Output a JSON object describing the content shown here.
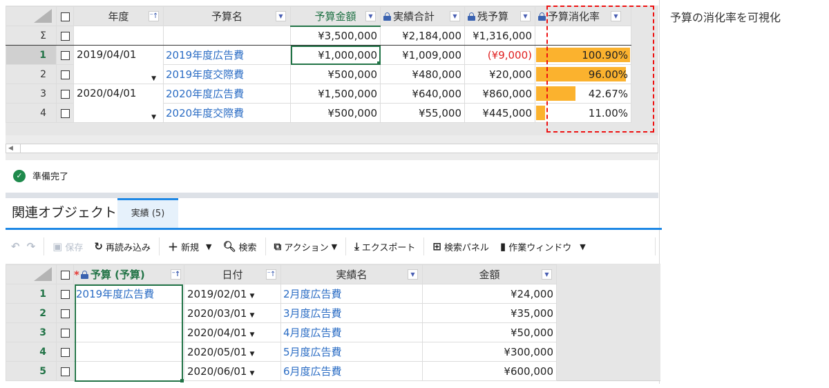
{
  "annotation": "予算の消化率を可視化",
  "top_grid": {
    "columns": [
      {
        "label": "年度",
        "button": "sort"
      },
      {
        "label": "予算名",
        "button": "filter"
      },
      {
        "label": "予算金額",
        "button": "filter",
        "active": true
      },
      {
        "label": "実績合計",
        "button": "filter",
        "locked": true
      },
      {
        "label": "残予算",
        "button": "filter",
        "locked": true
      },
      {
        "label": "予算消化率",
        "button": "filter",
        "locked": true
      }
    ],
    "summary": {
      "row_header": "Σ",
      "budget": "¥3,500,000",
      "actual_total": "¥2,184,000",
      "remaining": "¥1,316,000"
    },
    "rows": [
      {
        "num": "1",
        "year": "2019/04/01",
        "name": "2019年度広告費",
        "budget": "¥1,000,000",
        "actual_total": "¥1,009,000",
        "remaining": "(¥9,000)",
        "remaining_negative": true,
        "rate_label": "100.90%",
        "rate": 100.9
      },
      {
        "num": "2",
        "year": "",
        "name": "2019年度交際費",
        "budget": "¥500,000",
        "actual_total": "¥480,000",
        "remaining": "¥20,000",
        "rate_label": "96.00%",
        "rate": 96.0
      },
      {
        "num": "3",
        "year": "2020/04/01",
        "name": "2020年度広告費",
        "budget": "¥1,500,000",
        "actual_total": "¥640,000",
        "remaining": "¥860,000",
        "rate_label": "42.67%",
        "rate": 42.67
      },
      {
        "num": "4",
        "year": "",
        "name": "2020年度交際費",
        "budget": "¥500,000",
        "actual_total": "¥55,000",
        "remaining": "¥445,000",
        "rate_label": "11.00%",
        "rate": 11.0
      }
    ],
    "bar_color": "#fbb22e"
  },
  "status": {
    "text": "準備完了"
  },
  "related": {
    "title": "関連オブジェクト",
    "tab_label": "実績 (5)"
  },
  "toolbar": {
    "undo": "↶",
    "redo": "↷",
    "save": "保存",
    "reload": "再読み込み",
    "new": "新規",
    "search": "検索",
    "action": "アクション",
    "export": "エクスポート",
    "search_panel": "検索パネル",
    "work_window": "作業ウィンドウ"
  },
  "bottom_grid": {
    "columns": [
      {
        "label": "予算 (予算)",
        "required": true,
        "locked": true,
        "button": "sort",
        "active": true
      },
      {
        "label": "日付",
        "button": "sort"
      },
      {
        "label": "実績名",
        "button": "filter"
      },
      {
        "label": "金額",
        "button": "filter"
      }
    ],
    "rows": [
      {
        "num": "1",
        "budget": "2019年度広告費",
        "date": "2019/02/01",
        "name": "2月度広告費",
        "amount": "¥24,000"
      },
      {
        "num": "2",
        "budget": "",
        "date": "2020/03/01",
        "name": "3月度広告費",
        "amount": "¥35,000"
      },
      {
        "num": "3",
        "budget": "",
        "date": "2020/04/01",
        "name": "4月度広告費",
        "amount": "¥50,000"
      },
      {
        "num": "4",
        "budget": "",
        "date": "2020/05/01",
        "name": "5月度広告費",
        "amount": "¥300,000"
      },
      {
        "num": "5",
        "budget": "",
        "date": "2020/06/01",
        "name": "6月度広告費",
        "amount": "¥600,000"
      }
    ]
  }
}
